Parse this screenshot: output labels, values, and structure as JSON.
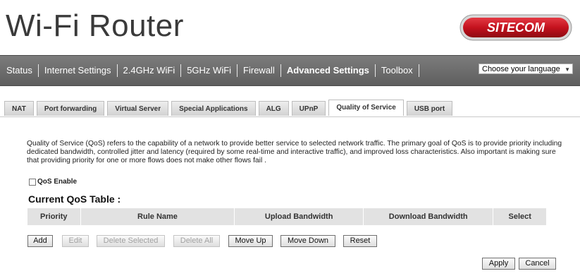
{
  "header": {
    "title": "Wi-Fi Router",
    "brand": "SITECOM"
  },
  "nav": {
    "items": [
      "Status",
      "Internet Settings",
      "2.4GHz WiFi",
      "5GHz WiFi",
      "Firewall",
      "Advanced Settings",
      "Toolbox"
    ],
    "active": "Advanced Settings",
    "language_select": "Choose your language"
  },
  "tabs": {
    "items": [
      "NAT",
      "Port forwarding",
      "Virtual Server",
      "Special Applications",
      "ALG",
      "UPnP",
      "Quality of Service",
      "USB port"
    ],
    "active": "Quality of Service"
  },
  "content": {
    "description": "Quality of Service (QoS) refers to the capability of a network to provide better service to selected network traffic. The primary goal of QoS is to provide priority including dedicated bandwidth, controlled jitter and latency (required by some real-time and interactive traffic), and improved loss characteristics. Also important is making sure that providing priority for one or more flows does not make other flows fail .",
    "qos_enable_label": "QoS Enable",
    "qos_enabled": false,
    "table_title": "Current QoS Table :",
    "columns": [
      "Priority",
      "Rule Name",
      "Upload Bandwidth",
      "Download Bandwidth",
      "Select"
    ]
  },
  "buttons": {
    "add": "Add",
    "edit": "Edit",
    "delete_selected": "Delete Selected",
    "delete_all": "Delete All",
    "move_up": "Move Up",
    "move_down": "Move Down",
    "reset": "Reset",
    "apply": "Apply",
    "cancel": "Cancel"
  },
  "colors": {
    "navbar": "#6b6b6b",
    "brand_red": "#c4121e",
    "tab_active": "#ffffff"
  }
}
